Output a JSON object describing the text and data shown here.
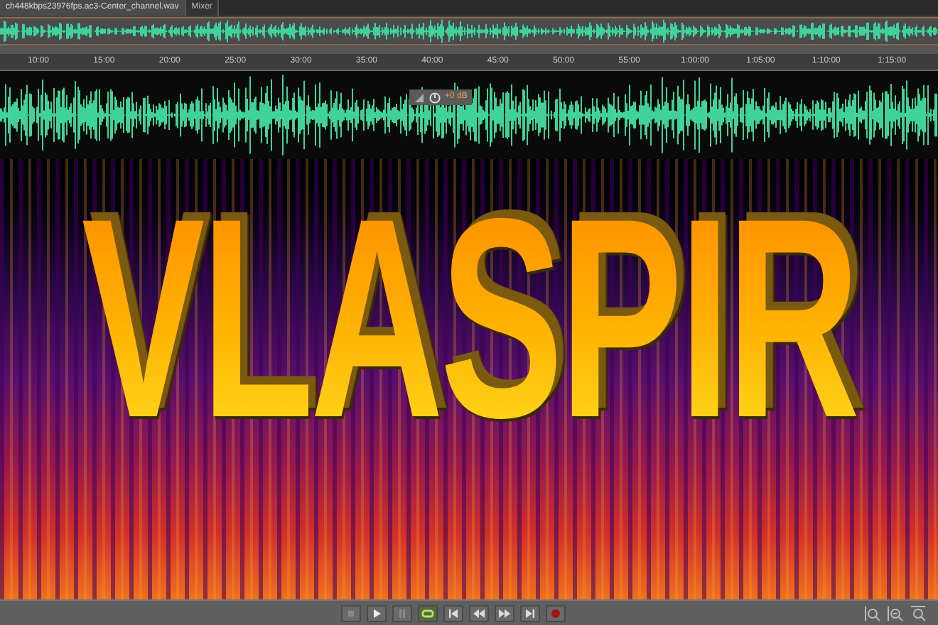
{
  "tabs": [
    {
      "label": "ch448kbps23976fps.ac3-Center_channel.wav",
      "selected": true
    },
    {
      "label": "Mixer",
      "selected": false
    }
  ],
  "ruler": {
    "labels": [
      "10:00",
      "15:00",
      "20:00",
      "25:00",
      "30:00",
      "35:00",
      "40:00",
      "45:00",
      "50:00",
      "55:00",
      "1:00:00",
      "1:05:00",
      "1:10:00",
      "1:15:00"
    ]
  },
  "hud": {
    "gain": "+0 dB"
  },
  "overlay_title": "VLASPIR",
  "transport": [
    {
      "kind": "stop",
      "on": false
    },
    {
      "kind": "play",
      "on": false
    },
    {
      "kind": "pause",
      "on": false
    },
    {
      "kind": "loop",
      "on": true
    },
    {
      "kind": "start",
      "on": false
    },
    {
      "kind": "rewind",
      "on": false
    },
    {
      "kind": "forward",
      "on": false
    },
    {
      "kind": "end",
      "on": false
    },
    {
      "kind": "record",
      "on": false
    }
  ],
  "zoom_tools": [
    {
      "kind": "zoom-in-amplitude"
    },
    {
      "kind": "zoom-out-amplitude"
    },
    {
      "kind": "zoom-full"
    }
  ]
}
